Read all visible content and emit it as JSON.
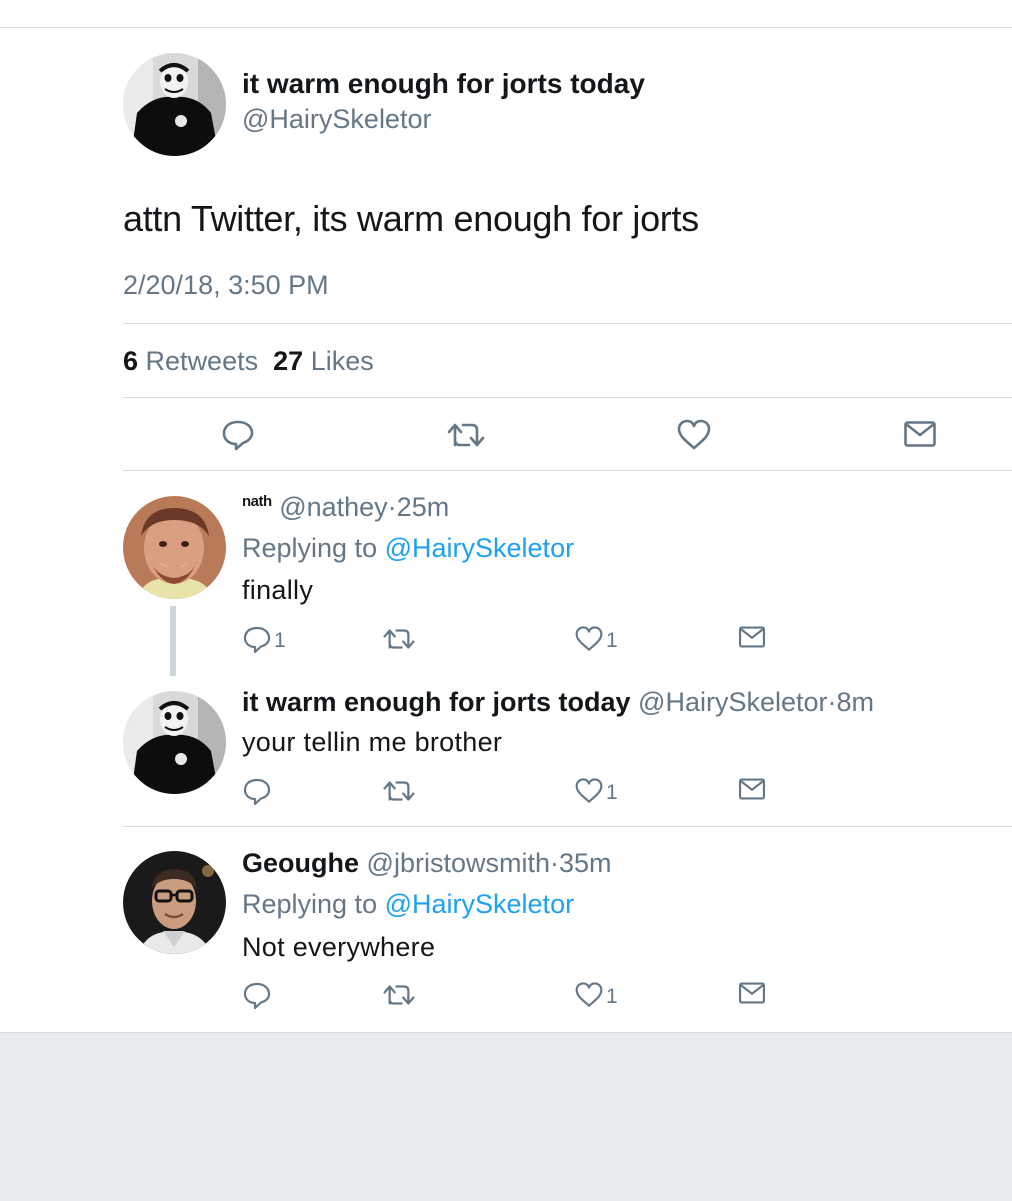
{
  "main_tweet": {
    "display_name": "it warm enough for jorts today",
    "handle": "@HairySkeletor",
    "text": "attn Twitter, its warm enough for jorts",
    "timestamp": "2/20/18, 3:50 PM",
    "retweet_count": "6",
    "retweets_label": "Retweets",
    "like_count": "27",
    "likes_label": "Likes",
    "actions": [
      "reply-icon",
      "retweet-icon",
      "like-icon",
      "message-icon"
    ]
  },
  "replies": [
    {
      "display_name": "nath",
      "handle": "@nathey",
      "age": "25m",
      "replying_label": "Replying to",
      "replying_to": "@HairySkeletor",
      "text": "finally",
      "reply_count": "1",
      "like_count": "1"
    },
    {
      "display_name": "it warm enough for jorts today",
      "handle": "@HairySkeletor",
      "age": "8m",
      "text": "your tellin me brother",
      "reply_count": "",
      "like_count": "1"
    },
    {
      "display_name": "Geoughe",
      "handle": "@jbristowsmith",
      "age": "35m",
      "replying_label": "Replying to",
      "replying_to": "@HairySkeletor",
      "text": "Not everywhere",
      "reply_count": "",
      "like_count": "1"
    }
  ],
  "separator": "·",
  "colors": {
    "link": "#1da1f2",
    "secondary_text": "#657786",
    "primary_text": "#14171a",
    "divider": "#d6dbdf",
    "background_footer": "#e6ecf0"
  }
}
